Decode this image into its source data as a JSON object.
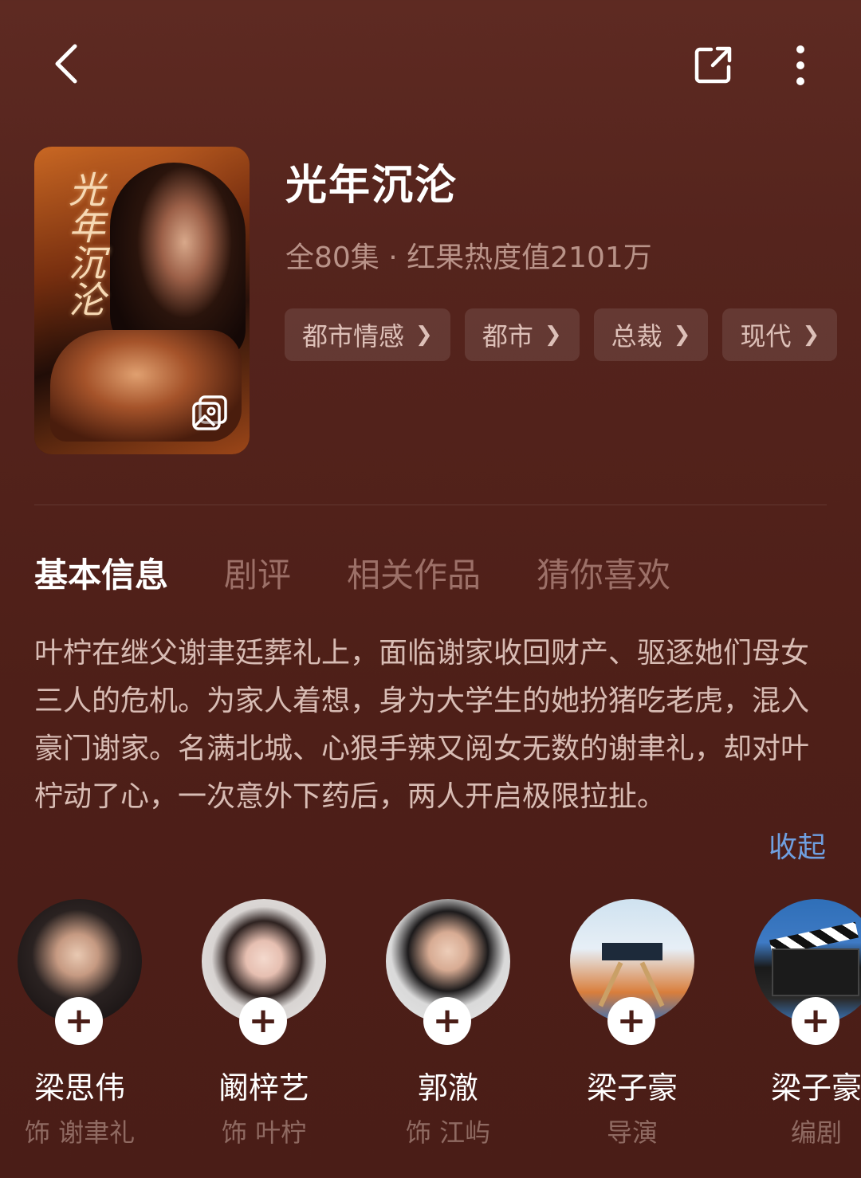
{
  "header": {
    "back_icon": "chevron-left-icon",
    "share_icon": "share-external-icon",
    "more_icon": "more-vertical-icon"
  },
  "poster": {
    "calligraphy": "光年沉沦",
    "gallery_icon": "gallery-icon"
  },
  "drama": {
    "title": "光年沉沦",
    "meta": "全80集 · 红果热度值2101万",
    "tags": [
      {
        "label": "都市情感"
      },
      {
        "label": "都市"
      },
      {
        "label": "总裁"
      },
      {
        "label": "现代"
      }
    ]
  },
  "tabs": [
    {
      "label": "基本信息",
      "active": true
    },
    {
      "label": "剧评"
    },
    {
      "label": "相关作品"
    },
    {
      "label": "猜你喜欢"
    }
  ],
  "synopsis": {
    "text": "叶柠在继父谢聿廷葬礼上，面临谢家收回财产、驱逐她们母女三人的危机。为家人着想，身为大学生的她扮猪吃老虎，混入豪门谢家。名满北城、心狠手辣又阅女无数的谢聿礼，却对叶柠动了心，一次意外下药后，两人开启极限拉扯。",
    "collapse_label": "收起"
  },
  "cast": [
    {
      "name": "梁思伟",
      "role": "饰 谢聿礼"
    },
    {
      "name": "阚梓艺",
      "role": "饰 叶柠"
    },
    {
      "name": "郭澈",
      "role": "饰 江屿"
    },
    {
      "name": "梁子豪",
      "role": "导演"
    },
    {
      "name": "梁子豪",
      "role": "编剧"
    }
  ],
  "colors": {
    "background": "#55241d",
    "accent_link": "#6f9fe0",
    "muted_text": "#b99389"
  }
}
